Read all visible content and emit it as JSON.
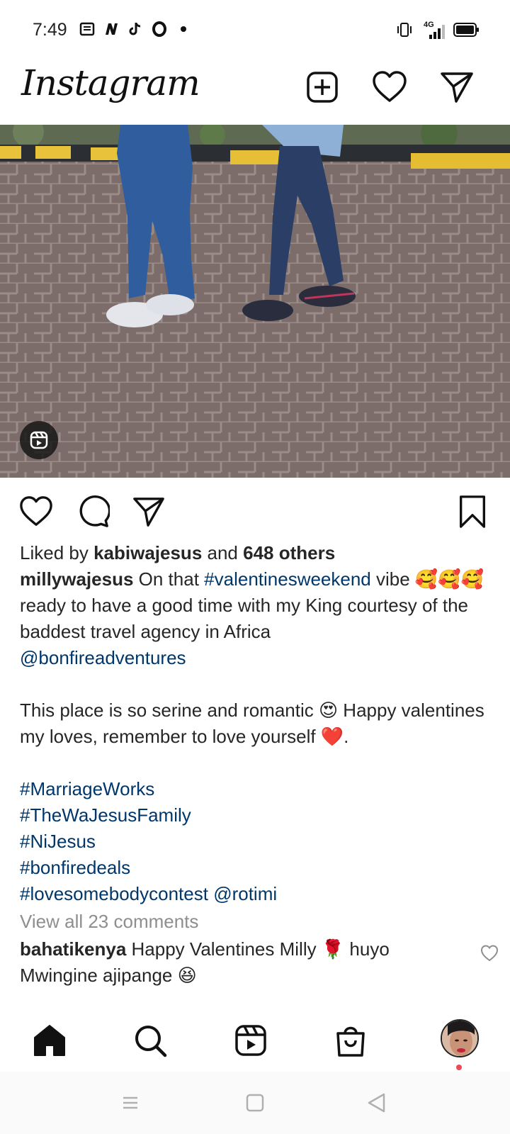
{
  "status_bar": {
    "time": "7:49",
    "left_icons": [
      "news-icon",
      "n-app-icon",
      "tiktok-icon",
      "opera-icon",
      "dot-icon"
    ],
    "right_icons": [
      "vibrate-icon",
      "signal-4g-icon",
      "battery-icon"
    ],
    "network_label": "4G"
  },
  "app_bar": {
    "logo": "Instagram",
    "icons": [
      "new-post-icon",
      "heart-icon",
      "direct-message-icon"
    ]
  },
  "post": {
    "media_type": "reel",
    "reel_badge_icon": "reels-icon",
    "actions": [
      "like-icon",
      "comment-icon",
      "share-icon",
      "save-icon"
    ],
    "likes": {
      "prefix": "Liked by ",
      "user": "kabiwajesus",
      "middle": " and ",
      "others": "648 others"
    },
    "caption": {
      "user": "millywajesus",
      "l1_text": " On that ",
      "l1_tag": "#valentinesweekend",
      "l1_rest": " vibe 🥰🥰🥰 ready to have a good time with my King courtesy of the baddest travel agency in Africa",
      "mention": "@bonfireadventures",
      "para2": "This place is so serine and romantic 😍 Happy valentines my loves, remember to love yourself ❤️.",
      "tags": [
        "#MarriageWorks",
        "#TheWaJesusFamily",
        "#NiJesus",
        "#bonfiredeals",
        "#lovesomebodycontest"
      ],
      "last_mention": "@rotimi"
    },
    "view_comments": "View all 23 comments",
    "comment": {
      "user": "bahatikenya",
      "text": " Happy Valentines Milly 🌹 huyo Mwingine ajipange 😆"
    }
  },
  "bottom_nav": {
    "items": [
      "home-icon",
      "search-icon",
      "reels-icon",
      "shop-icon",
      "profile-avatar"
    ]
  },
  "system_nav": {
    "items": [
      "menu-icon",
      "home-square-icon",
      "back-icon"
    ]
  },
  "colors": {
    "link": "#00376b",
    "muted": "#8e8e8e",
    "text": "#262626",
    "notification": "#ed4956"
  }
}
